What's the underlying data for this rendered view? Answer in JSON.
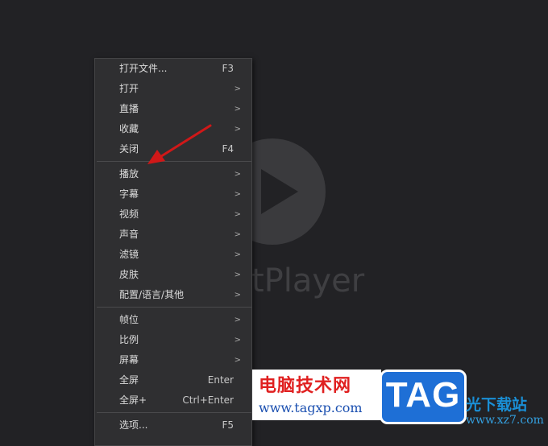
{
  "player": {
    "brand_text": "tPlayer"
  },
  "menu": {
    "items": [
      {
        "label": "打开文件...",
        "shortcut": "F3",
        "arrow": ""
      },
      {
        "label": "打开",
        "shortcut": "",
        "arrow": ">"
      },
      {
        "label": "直播",
        "shortcut": "",
        "arrow": ">"
      },
      {
        "label": "收藏",
        "shortcut": "",
        "arrow": ">"
      },
      {
        "label": "关闭",
        "shortcut": "F4",
        "arrow": ""
      },
      {
        "label": "播放",
        "shortcut": "",
        "arrow": ">"
      },
      {
        "label": "字幕",
        "shortcut": "",
        "arrow": ">"
      },
      {
        "label": "视频",
        "shortcut": "",
        "arrow": ">"
      },
      {
        "label": "声音",
        "shortcut": "",
        "arrow": ">"
      },
      {
        "label": "滤镜",
        "shortcut": "",
        "arrow": ">"
      },
      {
        "label": "皮肤",
        "shortcut": "",
        "arrow": ">"
      },
      {
        "label": "配置/语言/其他",
        "shortcut": "",
        "arrow": ">"
      },
      {
        "label": "帧位",
        "shortcut": "",
        "arrow": ">"
      },
      {
        "label": "比例",
        "shortcut": "",
        "arrow": ">"
      },
      {
        "label": "屏幕",
        "shortcut": "",
        "arrow": ">"
      },
      {
        "label": "全屏",
        "shortcut": "Enter",
        "arrow": ""
      },
      {
        "label": "全屏+",
        "shortcut": "Ctrl+Enter",
        "arrow": ""
      },
      {
        "label": "选项...",
        "shortcut": "F5",
        "arrow": ""
      }
    ]
  },
  "watermark": {
    "site_name": "电脑技术网",
    "site_url": "www.tagxp.com",
    "tag_text": "TAG",
    "right_name": "光下载站",
    "right_url": "www.xz7.com"
  },
  "colors": {
    "background": "#222225",
    "menu_bg": "#2f2f31",
    "annotation_arrow": "#d01818"
  }
}
